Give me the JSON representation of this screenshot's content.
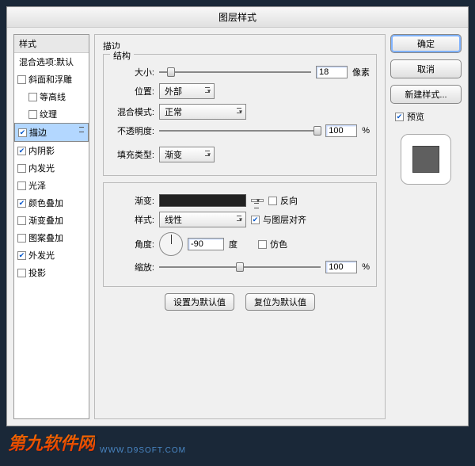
{
  "dialog": {
    "title": "图层样式"
  },
  "sidebar": {
    "header": "样式",
    "blend": "混合选项:默认",
    "items": [
      {
        "label": "斜面和浮雕",
        "checked": false,
        "selected": false
      },
      {
        "label": "等高线",
        "checked": false,
        "selected": false,
        "indent": true
      },
      {
        "label": "纹理",
        "checked": false,
        "selected": false,
        "indent": true
      },
      {
        "label": "描边",
        "checked": true,
        "selected": true
      },
      {
        "label": "内阴影",
        "checked": true,
        "selected": false
      },
      {
        "label": "内发光",
        "checked": false,
        "selected": false
      },
      {
        "label": "光泽",
        "checked": false,
        "selected": false
      },
      {
        "label": "颜色叠加",
        "checked": true,
        "selected": false
      },
      {
        "label": "渐变叠加",
        "checked": false,
        "selected": false
      },
      {
        "label": "图案叠加",
        "checked": false,
        "selected": false
      },
      {
        "label": "外发光",
        "checked": true,
        "selected": false
      },
      {
        "label": "投影",
        "checked": false,
        "selected": false
      }
    ]
  },
  "panel": {
    "title": "描边",
    "structure": {
      "legend": "结构",
      "size_label": "大小:",
      "size_value": "18",
      "size_unit": "像素",
      "position_label": "位置:",
      "position_value": "外部",
      "blend_label": "混合模式:",
      "blend_value": "正常",
      "opacity_label": "不透明度:",
      "opacity_value": "100",
      "opacity_unit": "%"
    },
    "fill": {
      "type_label": "填充类型:",
      "type_value": "渐变",
      "gradient_label": "渐变:",
      "reverse_label": "反向",
      "reverse_checked": false,
      "style_label": "样式:",
      "style_value": "线性",
      "align_label": "与图层对齐",
      "align_checked": true,
      "angle_label": "角度:",
      "angle_value": "-90",
      "angle_unit": "度",
      "dither_label": "仿色",
      "dither_checked": false,
      "scale_label": "缩放:",
      "scale_value": "100",
      "scale_unit": "%"
    },
    "buttons": {
      "default": "设置为默认值",
      "reset": "复位为默认值"
    }
  },
  "right": {
    "ok": "确定",
    "cancel": "取消",
    "newstyle": "新建样式...",
    "preview_label": "预览",
    "preview_checked": true
  },
  "watermark": {
    "cn": "第九软件网",
    "en": "WWW.D9SOFT.COM"
  }
}
